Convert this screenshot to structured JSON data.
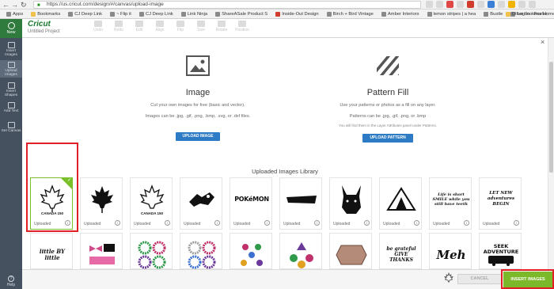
{
  "browser": {
    "nav_back": "←",
    "nav_forward": "→",
    "nav_reload": "↻",
    "url": "https://us.cricut.com/design/#/canvas/upload-image",
    "bookmarks": [
      "Apps",
      "Bookmarks",
      "CJ Deep Link",
      "~ Flip it",
      "CJ Deep Link",
      "Link Ninja",
      "ShareASale Product S",
      "Inside-Out Design",
      "Birch + Bird Vintage",
      "Amber Interiors",
      "lemon stripes | a hea",
      "Bustle",
      "Log In - Fox Home S"
    ],
    "other_bookmarks": "Other bookmarks"
  },
  "header": {
    "logo": "Cricut",
    "project": "Untitled Project",
    "tools": [
      "Undo",
      "Redo",
      "Edit",
      "Align",
      "Flip",
      "Size",
      "Rotate",
      "Position"
    ]
  },
  "sidebar": {
    "new": "New",
    "items": [
      {
        "label": "Insert Images",
        "icon": "image-icon"
      },
      {
        "label": "Upload Images",
        "icon": "upload-icon"
      },
      {
        "label": "Insert Shapes",
        "icon": "shapes-icon"
      },
      {
        "label": "Add Text",
        "icon": "text-icon"
      },
      {
        "label": "Set Canvas",
        "icon": "canvas-icon"
      }
    ],
    "help": "Help"
  },
  "upload_image": {
    "title": "Image",
    "desc1": "Cut your own images for free (basic and vector).",
    "desc2": "Images can be .jpg, .gif, .png, .bmp, .svg, or .dxf files.",
    "button": "UPLOAD IMAGE"
  },
  "upload_pattern": {
    "title": "Pattern Fill",
    "desc1": "Use your patterns or photos as a fill on any layer.",
    "desc2": "Patterns can be .jpg, .gif, .png, or .bmp",
    "note": "You will find them in the Layer Attributes panel under Patterns.",
    "button": "UPLOAD PATTERN"
  },
  "library": {
    "title": "Uploaded Images Library",
    "row1": [
      {
        "caption": "Uploaded",
        "thumb": "maple-leaf-outline",
        "label": "CANADA 150",
        "selected": true
      },
      {
        "caption": "Uploaded",
        "thumb": "maple-leaf-solid",
        "label": ""
      },
      {
        "caption": "Uploaded",
        "thumb": "maple-leaf-outline",
        "label": "CANADA 150"
      },
      {
        "caption": "Uploaded",
        "thumb": "pokemon-ball",
        "label": ""
      },
      {
        "caption": "Uploaded",
        "thumb": "pokemon-text",
        "label": "POKéMON"
      },
      {
        "caption": "Uploaded",
        "thumb": "pokemon-text-dark",
        "label": ""
      },
      {
        "caption": "Uploaded",
        "thumb": "pikachu",
        "label": ""
      },
      {
        "caption": "Uploaded",
        "thumb": "tent",
        "label": ""
      },
      {
        "caption": "Uploaded",
        "thumb": "script-text",
        "label": "Life is short SMILE while you still have teeth"
      },
      {
        "caption": "Uploaded",
        "thumb": "script-text",
        "label": "LET NEW adventures BEGIN"
      }
    ],
    "row2": [
      {
        "thumb": "script-text",
        "label": "little BY little"
      },
      {
        "thumb": "bows",
        "label": ""
      },
      {
        "thumb": "wreath-green",
        "label": ""
      },
      {
        "thumb": "wreath-pink",
        "label": ""
      },
      {
        "thumb": "stars-multi",
        "label": ""
      },
      {
        "thumb": "ornaments",
        "label": ""
      },
      {
        "thumb": "oval-stamp",
        "label": ""
      },
      {
        "thumb": "script-text",
        "label": "be grateful GIVE THANKS"
      },
      {
        "thumb": "script-text",
        "label": "Meh"
      },
      {
        "thumb": "van",
        "label": "SEEK ADVENTURE"
      }
    ]
  },
  "footer": {
    "cancel": "CANCEL",
    "insert": "INSERT IMAGES"
  },
  "colors": {
    "accent_green": "#7bb82a",
    "sidebar": "#45515f",
    "button_blue": "#2e7bc5",
    "highlight_red": "#e01f26"
  }
}
